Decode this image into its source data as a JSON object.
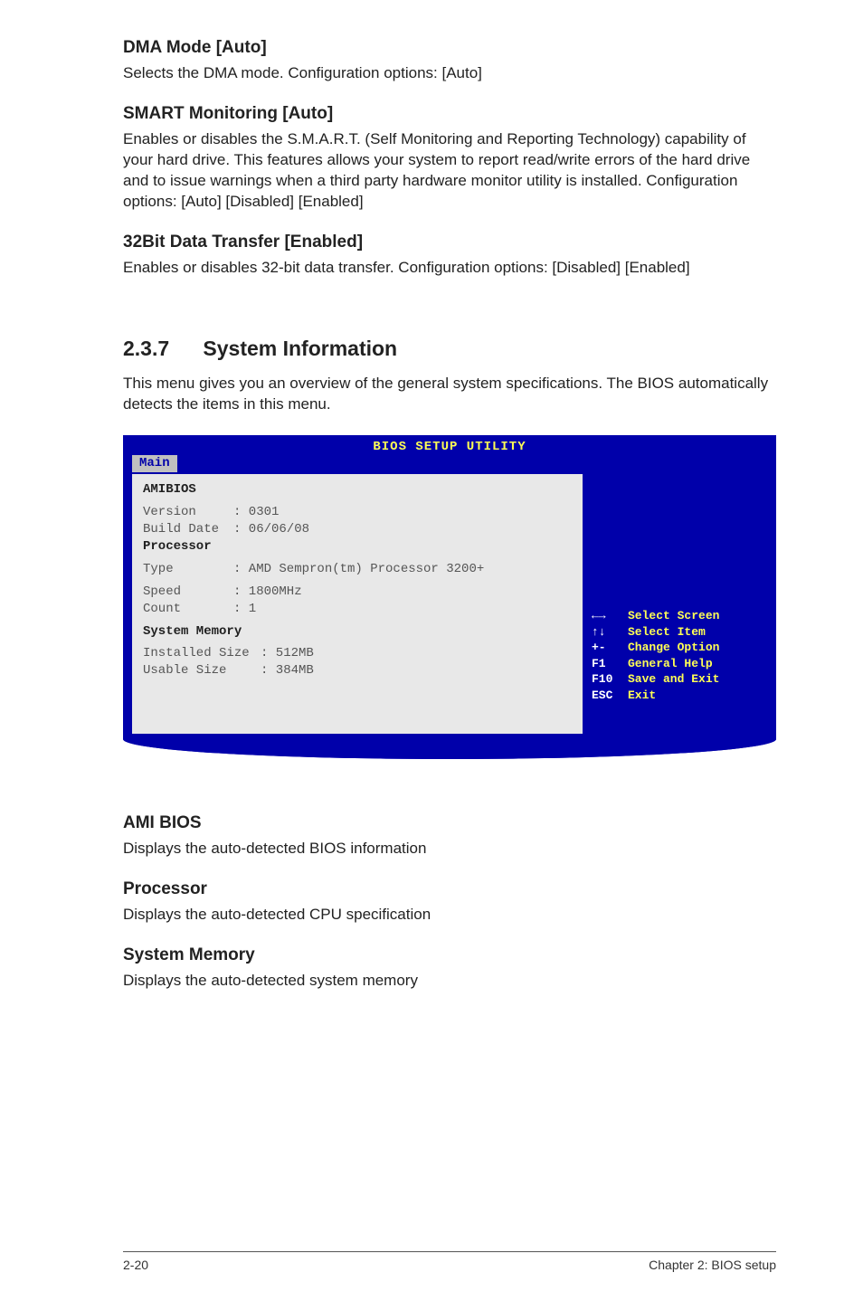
{
  "sections": {
    "dma": {
      "heading": "DMA Mode [Auto]",
      "body": "Selects the DMA mode. Configuration options: [Auto]"
    },
    "smart": {
      "heading": "SMART Monitoring [Auto]",
      "body": "Enables or disables the S.M.A.R.T. (Self Monitoring and Reporting Technology) capability of your hard drive. This features allows your system to report read/write errors of the hard drive and to issue warnings when a third party hardware monitor utility is installed. Configuration options: [Auto] [Disabled] [Enabled]"
    },
    "bit32": {
      "heading": "32Bit Data Transfer [Enabled]",
      "body": "Enables or disables 32-bit data transfer. Configuration options: [Disabled] [Enabled]"
    },
    "sysinfo": {
      "num": "2.3.7",
      "title": "System Information",
      "body": "This menu gives you an overview of the general system specifications. The BIOS automatically detects the items in this menu."
    },
    "amibios": {
      "heading": "AMI BIOS",
      "body": "Displays the auto-detected BIOS information"
    },
    "processor": {
      "heading": "Processor",
      "body": "Displays the auto-detected CPU specification"
    },
    "sysmem": {
      "heading": "System Memory",
      "body": "Displays the auto-detected system memory"
    }
  },
  "bios": {
    "title": "BIOS SETUP UTILITY",
    "tab": "Main",
    "left": {
      "amibios": "AMIBIOS",
      "version_label": "Version",
      "version_value": ": 0301",
      "build_label": "Build Date",
      "build_value": ": 06/06/08",
      "processor": "Processor",
      "type_label": "Type",
      "type_value": ": AMD Sempron(tm) Processor 3200+",
      "speed_label": "Speed",
      "speed_value": ": 1800MHz",
      "count_label": "Count",
      "count_value": ": 1",
      "sysmem": "System Memory",
      "inst_label": "Installed Size",
      "inst_value": ": 512MB",
      "usable_label": "Usable Size",
      "usable_value": ": 384MB"
    },
    "right": {
      "r1s": "←→",
      "r1t": "Select Screen",
      "r2s": "↑↓",
      "r2t": "Select Item",
      "r3s": "+-",
      "r3t": "Change Option",
      "r4s": "F1",
      "r4t": "General Help",
      "r5s": "F10",
      "r5t": "Save and Exit",
      "r6s": "ESC",
      "r6t": "Exit"
    }
  },
  "footer": {
    "left": "2-20",
    "right": "Chapter 2: BIOS setup"
  }
}
